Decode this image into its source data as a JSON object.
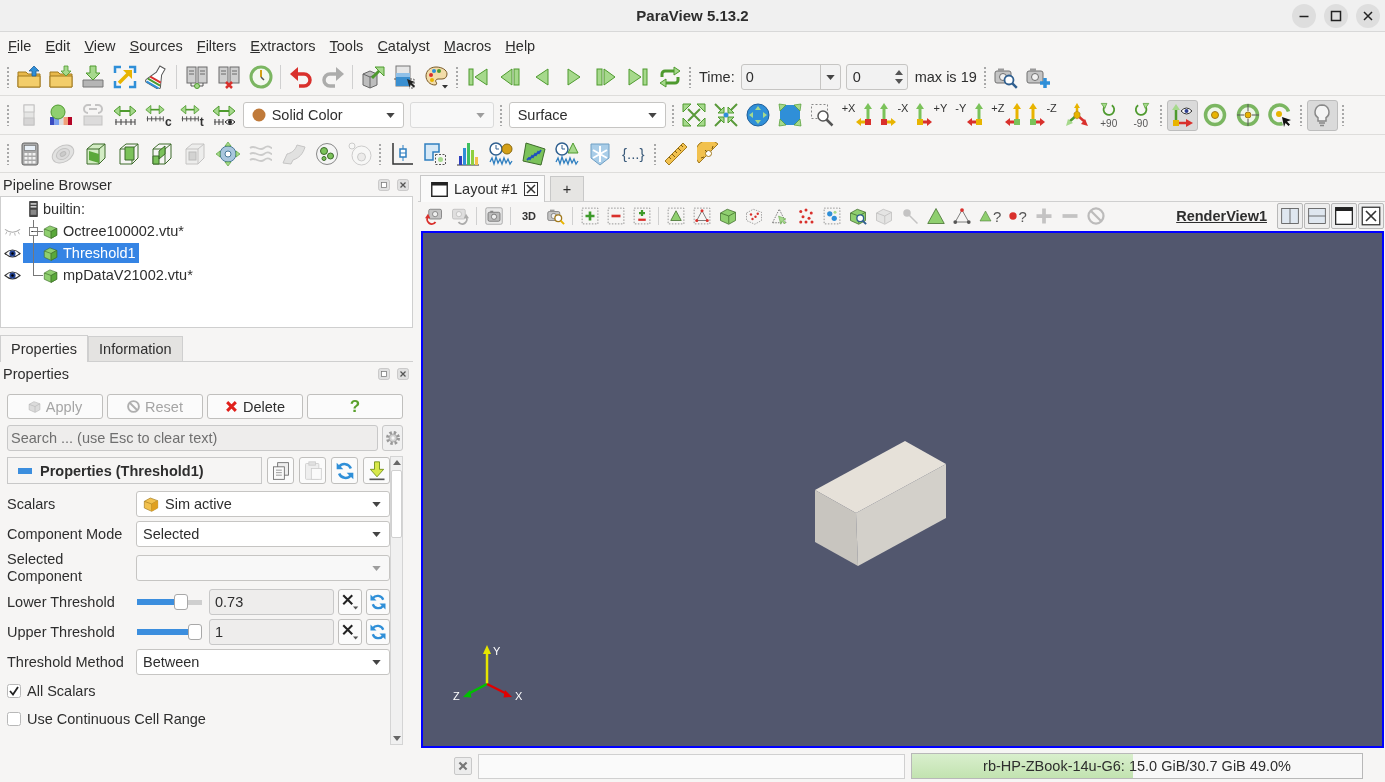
{
  "window": {
    "title": "ParaView 5.13.2"
  },
  "menu": [
    "File",
    "Edit",
    "View",
    "Sources",
    "Filters",
    "Extractors",
    "Tools",
    "Catalyst",
    "Macros",
    "Help"
  ],
  "toolbars": [
    {
      "items": [
        {
          "kind": "grip"
        },
        {
          "kind": "button",
          "disabled": false
        },
        {
          "kind": "button",
          "disabled": false
        },
        {
          "kind": "button",
          "disabled": false
        },
        {
          "kind": "button",
          "disabled": false
        },
        {
          "kind": "button",
          "disabled": false
        },
        {
          "kind": "separator"
        },
        {
          "kind": "button",
          "disabled": false
        },
        {
          "kind": "button",
          "disabled": false
        },
        {
          "kind": "button",
          "disabled": false
        },
        {
          "kind": "separator"
        },
        {
          "kind": "button",
          "disabled": false
        },
        {
          "kind": "button",
          "disabled": true
        },
        {
          "kind": "separator"
        },
        {
          "kind": "button",
          "disabled": false
        },
        {
          "kind": "button",
          "disabled": false
        },
        {
          "kind": "button",
          "disabled": false
        },
        {
          "kind": "grip"
        },
        {
          "kind": "button",
          "disabled": false
        },
        {
          "kind": "button",
          "disabled": false
        },
        {
          "kind": "button",
          "disabled": false
        },
        {
          "kind": "button",
          "disabled": false
        },
        {
          "kind": "button",
          "disabled": false
        },
        {
          "kind": "button",
          "disabled": false
        },
        {
          "kind": "button",
          "disabled": false
        },
        {
          "kind": "grip"
        },
        {
          "kind": "label",
          "text": "Time:"
        },
        {
          "kind": "time-combo",
          "value": "0"
        },
        {
          "kind": "spin",
          "value": "0"
        },
        {
          "kind": "label",
          "text": "max is 19"
        },
        {
          "kind": "grip"
        },
        {
          "kind": "button",
          "disabled": false
        },
        {
          "kind": "button",
          "disabled": false
        }
      ]
    },
    {
      "items": [
        {
          "kind": "grip"
        },
        {
          "kind": "button",
          "disabled": true
        },
        {
          "kind": "button",
          "disabled": false
        },
        {
          "kind": "button",
          "disabled": true
        },
        {
          "kind": "button",
          "disabled": false
        },
        {
          "kind": "button",
          "label": "c",
          "disabled": false
        },
        {
          "kind": "button",
          "label": "t",
          "disabled": false
        },
        {
          "kind": "button",
          "disabled": false
        },
        {
          "kind": "coloring-combo",
          "value": "Solid Color",
          "disabled": false
        },
        {
          "kind": "combo",
          "disabled": true
        },
        {
          "kind": "grip"
        },
        {
          "kind": "combo",
          "value": "Surface",
          "disabled": false
        },
        {
          "kind": "grip"
        },
        {
          "kind": "button",
          "disabled": false
        },
        {
          "kind": "button",
          "disabled": false
        },
        {
          "kind": "button",
          "disabled": false
        },
        {
          "kind": "button",
          "disabled": false
        },
        {
          "kind": "button",
          "disabled": false
        },
        {
          "kind": "button",
          "label": "+X",
          "disabled": false
        },
        {
          "kind": "button",
          "label": "-X",
          "disabled": false
        },
        {
          "kind": "button",
          "label": "+Y",
          "disabled": false
        },
        {
          "kind": "button",
          "label": "-Y",
          "disabled": false
        },
        {
          "kind": "button",
          "label": "+Z",
          "disabled": false
        },
        {
          "kind": "button",
          "label": "-Z",
          "disabled": false
        },
        {
          "kind": "button",
          "disabled": false
        },
        {
          "kind": "button",
          "label": "+90",
          "disabled": false
        },
        {
          "kind": "button",
          "label": "-90",
          "disabled": false
        },
        {
          "kind": "grip"
        },
        {
          "kind": "toggle",
          "on": true
        },
        {
          "kind": "toggle",
          "on": false
        },
        {
          "kind": "button",
          "disabled": false
        },
        {
          "kind": "toggle",
          "on": false
        },
        {
          "kind": "grip"
        },
        {
          "kind": "toggle",
          "on": true
        },
        {
          "kind": "grip"
        }
      ]
    },
    {
      "items": [
        {
          "kind": "grip"
        },
        {
          "kind": "button",
          "disabled": false
        },
        {
          "kind": "button",
          "disabled": true
        },
        {
          "kind": "button",
          "disabled": false
        },
        {
          "kind": "button",
          "disabled": false
        },
        {
          "kind": "button",
          "disabled": false
        },
        {
          "kind": "button",
          "disabled": true
        },
        {
          "kind": "button",
          "disabled": false
        },
        {
          "kind": "button",
          "disabled": true
        },
        {
          "kind": "button",
          "disabled": true
        },
        {
          "kind": "button",
          "disabled": false
        },
        {
          "kind": "button",
          "disabled": true
        },
        {
          "kind": "grip"
        },
        {
          "kind": "button",
          "disabled": false
        },
        {
          "kind": "button",
          "disabled": false
        },
        {
          "kind": "button",
          "disabled": false
        },
        {
          "kind": "button",
          "disabled": false
        },
        {
          "kind": "button",
          "disabled": false
        },
        {
          "kind": "button",
          "disabled": false
        },
        {
          "kind": "button",
          "disabled": false
        },
        {
          "kind": "button",
          "label": "{...}",
          "disabled": false
        },
        {
          "kind": "grip"
        },
        {
          "kind": "button",
          "disabled": false
        },
        {
          "kind": "button",
          "disabled": false
        }
      ]
    }
  ],
  "pipeline_browser": {
    "title": "Pipeline Browser",
    "items": [
      {
        "label": "builtin:",
        "selected": false,
        "children": [
          {
            "label": "Octree100002.vtu*",
            "visible": false,
            "selected": false,
            "expanded": true,
            "children": [
              {
                "label": "Threshold1",
                "visible": true,
                "selected": true
              }
            ]
          },
          {
            "label": "mpDataV21002.vtu*",
            "visible": true,
            "selected": false
          }
        ]
      }
    ]
  },
  "panel_tabs": [
    {
      "label": "Properties",
      "selected": true
    },
    {
      "label": "Information",
      "selected": false
    }
  ],
  "properties": {
    "title": "Properties",
    "buttons": [
      {
        "label": "Apply",
        "disabled": true
      },
      {
        "label": "Reset",
        "disabled": true
      },
      {
        "label": "Delete",
        "disabled": false
      },
      {
        "label": "?",
        "disabled": false
      }
    ],
    "search": {
      "placeholder": "Search ... (use Esc to clear text)"
    },
    "section": {
      "title": "Properties (Threshold1)",
      "expanded": true,
      "tools": [
        {
          "disabled": false
        },
        {
          "disabled": true
        },
        {
          "disabled": false
        },
        {
          "disabled": false
        }
      ]
    },
    "rows": [
      {
        "kind": "array-combo",
        "label": "Scalars",
        "value": "Sim active",
        "disabled": false
      },
      {
        "kind": "combo",
        "label": "Component Mode",
        "value": "Selected",
        "disabled": false
      },
      {
        "kind": "combo",
        "label": "Selected Component",
        "disabled": true
      },
      {
        "kind": "slider",
        "label": "Lower Threshold",
        "level": 0.73,
        "value": "0.73",
        "disabled": false
      },
      {
        "kind": "slider",
        "label": "Upper Threshold",
        "level": 1,
        "value": "1",
        "disabled": false
      },
      {
        "kind": "combo",
        "label": "Threshold Method",
        "value": "Between",
        "disabled": false
      },
      {
        "kind": "checkbox",
        "label": "All Scalars",
        "checked": true,
        "disabled": false
      },
      {
        "kind": "checkbox",
        "label": "Use Continuous Cell Range",
        "checked": false,
        "disabled": false
      }
    ]
  },
  "layout_tabs": [
    {
      "kind": "layout",
      "label": "Layout #1",
      "selected": true
    },
    {
      "kind": "add",
      "label": "+",
      "selected": false
    }
  ],
  "view_toolbar": {
    "items": [
      {
        "kind": "button",
        "disabled": false
      },
      {
        "kind": "button",
        "disabled": true
      },
      {
        "kind": "separator"
      },
      {
        "kind": "button",
        "disabled": false
      },
      {
        "kind": "separator"
      },
      {
        "kind": "button",
        "label": "3D",
        "disabled": false
      },
      {
        "kind": "button",
        "disabled": false
      },
      {
        "kind": "separator"
      },
      {
        "kind": "button",
        "disabled": false
      },
      {
        "kind": "button",
        "disabled": false
      },
      {
        "kind": "button",
        "disabled": false
      },
      {
        "kind": "separator"
      },
      {
        "kind": "button",
        "disabled": false
      },
      {
        "kind": "button",
        "disabled": false
      },
      {
        "kind": "button",
        "disabled": false
      },
      {
        "kind": "button",
        "disabled": false
      },
      {
        "kind": "button",
        "disabled": false
      },
      {
        "kind": "button",
        "disabled": false
      },
      {
        "kind": "button",
        "disabled": false
      },
      {
        "kind": "button",
        "disabled": false
      },
      {
        "kind": "button",
        "disabled": true
      },
      {
        "kind": "button",
        "disabled": true
      },
      {
        "kind": "button",
        "disabled": false
      },
      {
        "kind": "button",
        "disabled": false
      },
      {
        "kind": "button",
        "label": "?",
        "disabled": false
      },
      {
        "kind": "button",
        "label": "?",
        "disabled": false
      },
      {
        "kind": "button",
        "disabled": true
      },
      {
        "kind": "button",
        "disabled": true
      },
      {
        "kind": "button",
        "disabled": true
      }
    ]
  },
  "view_title": "RenderView1",
  "axes": [
    {
      "label": "Y",
      "color": "#e6e600"
    },
    {
      "label": "Z",
      "color": "#00c000"
    },
    {
      "label": "X",
      "color": "#e00000"
    }
  ],
  "memory": {
    "text": "rb-HP-ZBook-14u-G6: 15.0 GiB/30.7 GiB 49.0%",
    "level": 0.49
  }
}
